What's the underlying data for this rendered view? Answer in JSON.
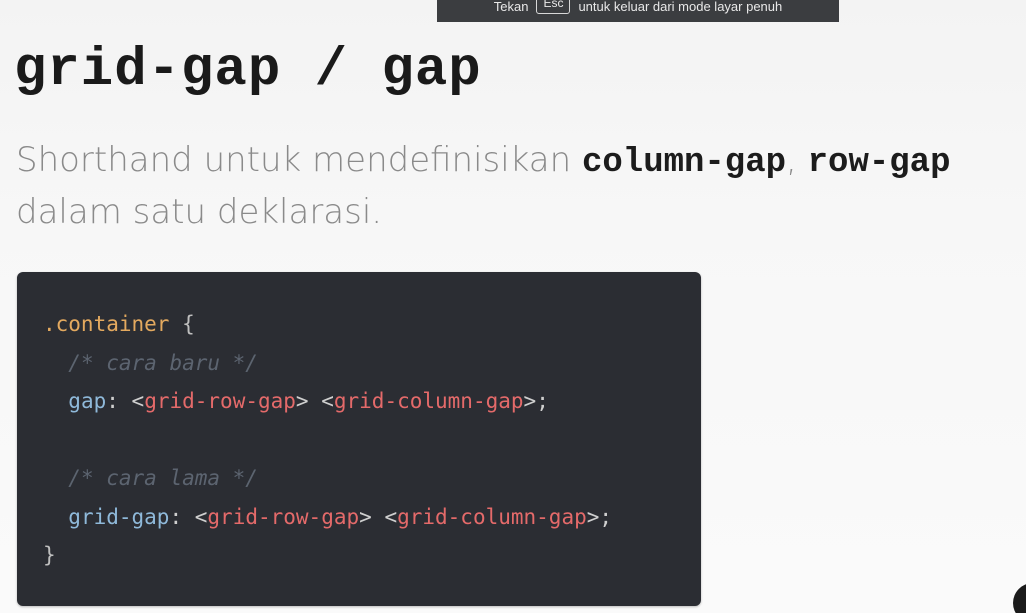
{
  "fullscreen_notice": {
    "prefix": "Tekan",
    "key": "Esc",
    "suffix": "untuk keluar dari mode layar penuh"
  },
  "slide": {
    "title": "grid-gap / gap",
    "description": {
      "part1": "Shorthand untuk mendefinisikan ",
      "code1": "column-gap",
      "part2": ", ",
      "code2": "row-gap",
      "part3": " dalam satu deklarasi."
    },
    "code": {
      "selector": ".container",
      "open_brace": "{",
      "comment_new": "/* cara baru */",
      "prop_gap": "gap",
      "colon": ": ",
      "val_row": "grid-row-gap",
      "val_col": "grid-column-gap",
      "lt": "<",
      "gt": ">",
      "space": " ",
      "semicolon": ";",
      "comment_old": "/* cara lama */",
      "prop_grid_gap": "grid-gap",
      "close_brace": "}"
    }
  },
  "colors": {
    "code_background": "#2b2d33",
    "selector": "#e3a95f",
    "property": "#8fb9da",
    "value": "#e46a6a",
    "comment": "#5c6470"
  }
}
